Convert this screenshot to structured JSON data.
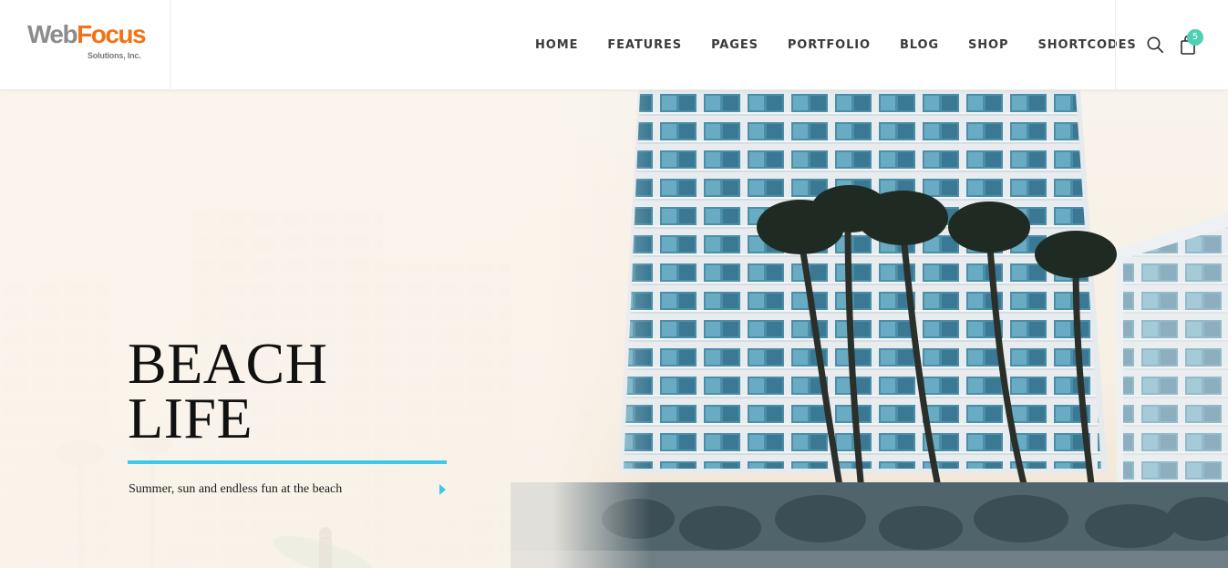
{
  "brand": {
    "logo_part1": "Web",
    "logo_part2": "Focus",
    "logo_sub": "Solutions, Inc.",
    "colors": {
      "web": "#8c8c8c",
      "focus": "#f47216"
    }
  },
  "nav": {
    "items": [
      {
        "label": "HOME"
      },
      {
        "label": "FEATURES"
      },
      {
        "label": "PAGES"
      },
      {
        "label": "PORTFOLIO"
      },
      {
        "label": "BLOG"
      },
      {
        "label": "SHOP"
      },
      {
        "label": "SHORTCODES"
      }
    ]
  },
  "header_icons": {
    "search_icon": "search-icon",
    "cart_icon": "shopping-bag-icon",
    "cart_count": "5",
    "badge_color": "#4ed1b0"
  },
  "hero": {
    "title_line1": "BEACH",
    "title_line2": "LIFE",
    "subtitle": "Summer, sun and endless fun at the beach",
    "accent_color": "#3ec8ec",
    "arrow_icon": "play-arrow-icon",
    "background_image": "beach-highrise-photo"
  }
}
